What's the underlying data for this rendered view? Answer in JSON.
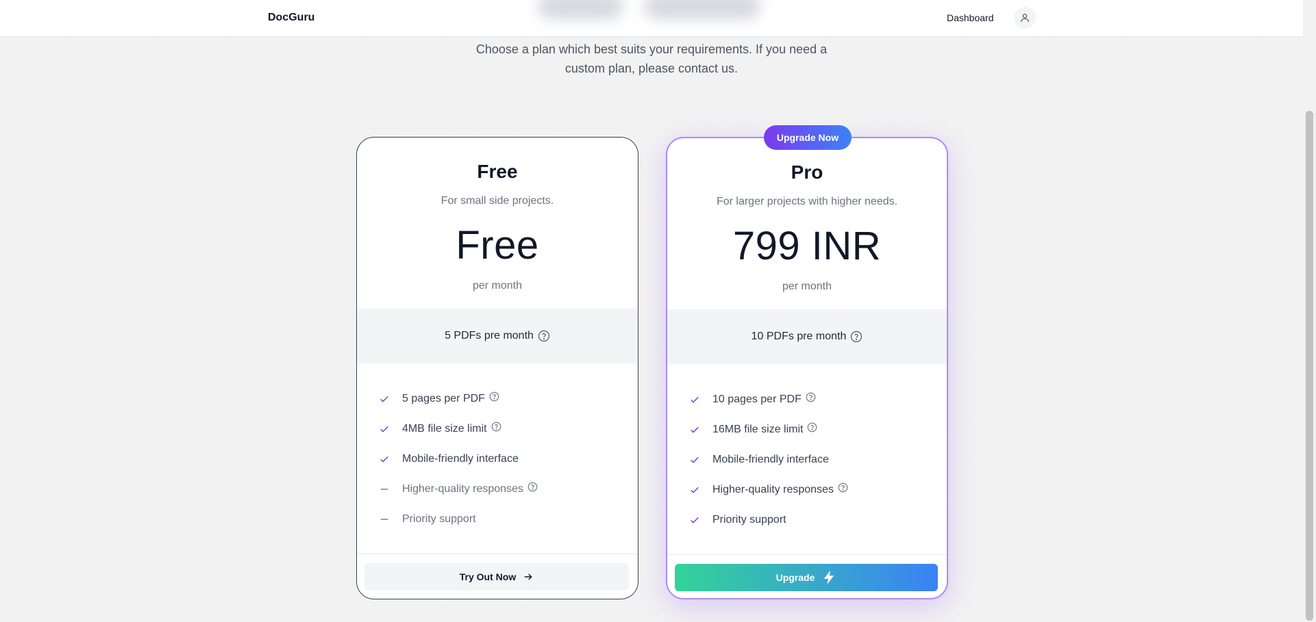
{
  "header": {
    "brand": "DocGuru",
    "dashboard_label": "Dashboard"
  },
  "intro": {
    "line1": "Choose a plan which best suits your requirements. If you need a",
    "line2": "custom plan, please contact us."
  },
  "plans": [
    {
      "name": "Free",
      "description": "For small side projects.",
      "price": "Free",
      "period": "per month",
      "quota": "5 PDFs pre month",
      "features": [
        {
          "label": "5 pages per PDF",
          "included": true,
          "help": true
        },
        {
          "label": "4MB file size limit",
          "included": true,
          "help": true
        },
        {
          "label": "Mobile-friendly interface",
          "included": true,
          "help": false
        },
        {
          "label": "Higher-quality responses",
          "included": false,
          "help": true
        },
        {
          "label": "Priority support",
          "included": false,
          "help": false
        }
      ],
      "cta": "Try Out Now"
    },
    {
      "name": "Pro",
      "badge": "Upgrade Now",
      "description": "For larger projects with higher needs.",
      "price": "799 INR",
      "period": "per month",
      "quota": "10 PDFs pre month",
      "features": [
        {
          "label": "10 pages per PDF",
          "included": true,
          "help": true
        },
        {
          "label": "16MB file size limit",
          "included": true,
          "help": true
        },
        {
          "label": "Mobile-friendly interface",
          "included": true,
          "help": false
        },
        {
          "label": "Higher-quality responses",
          "included": true,
          "help": true
        },
        {
          "label": "Priority support",
          "included": true,
          "help": false
        }
      ],
      "cta": "Upgrade"
    }
  ],
  "colors": {
    "accent_purple": "#7c3aed",
    "check": "#7c3aed",
    "pro_border": "#a78bfa",
    "gradient_green": "#34d399",
    "gradient_blue": "#3b82f6"
  }
}
